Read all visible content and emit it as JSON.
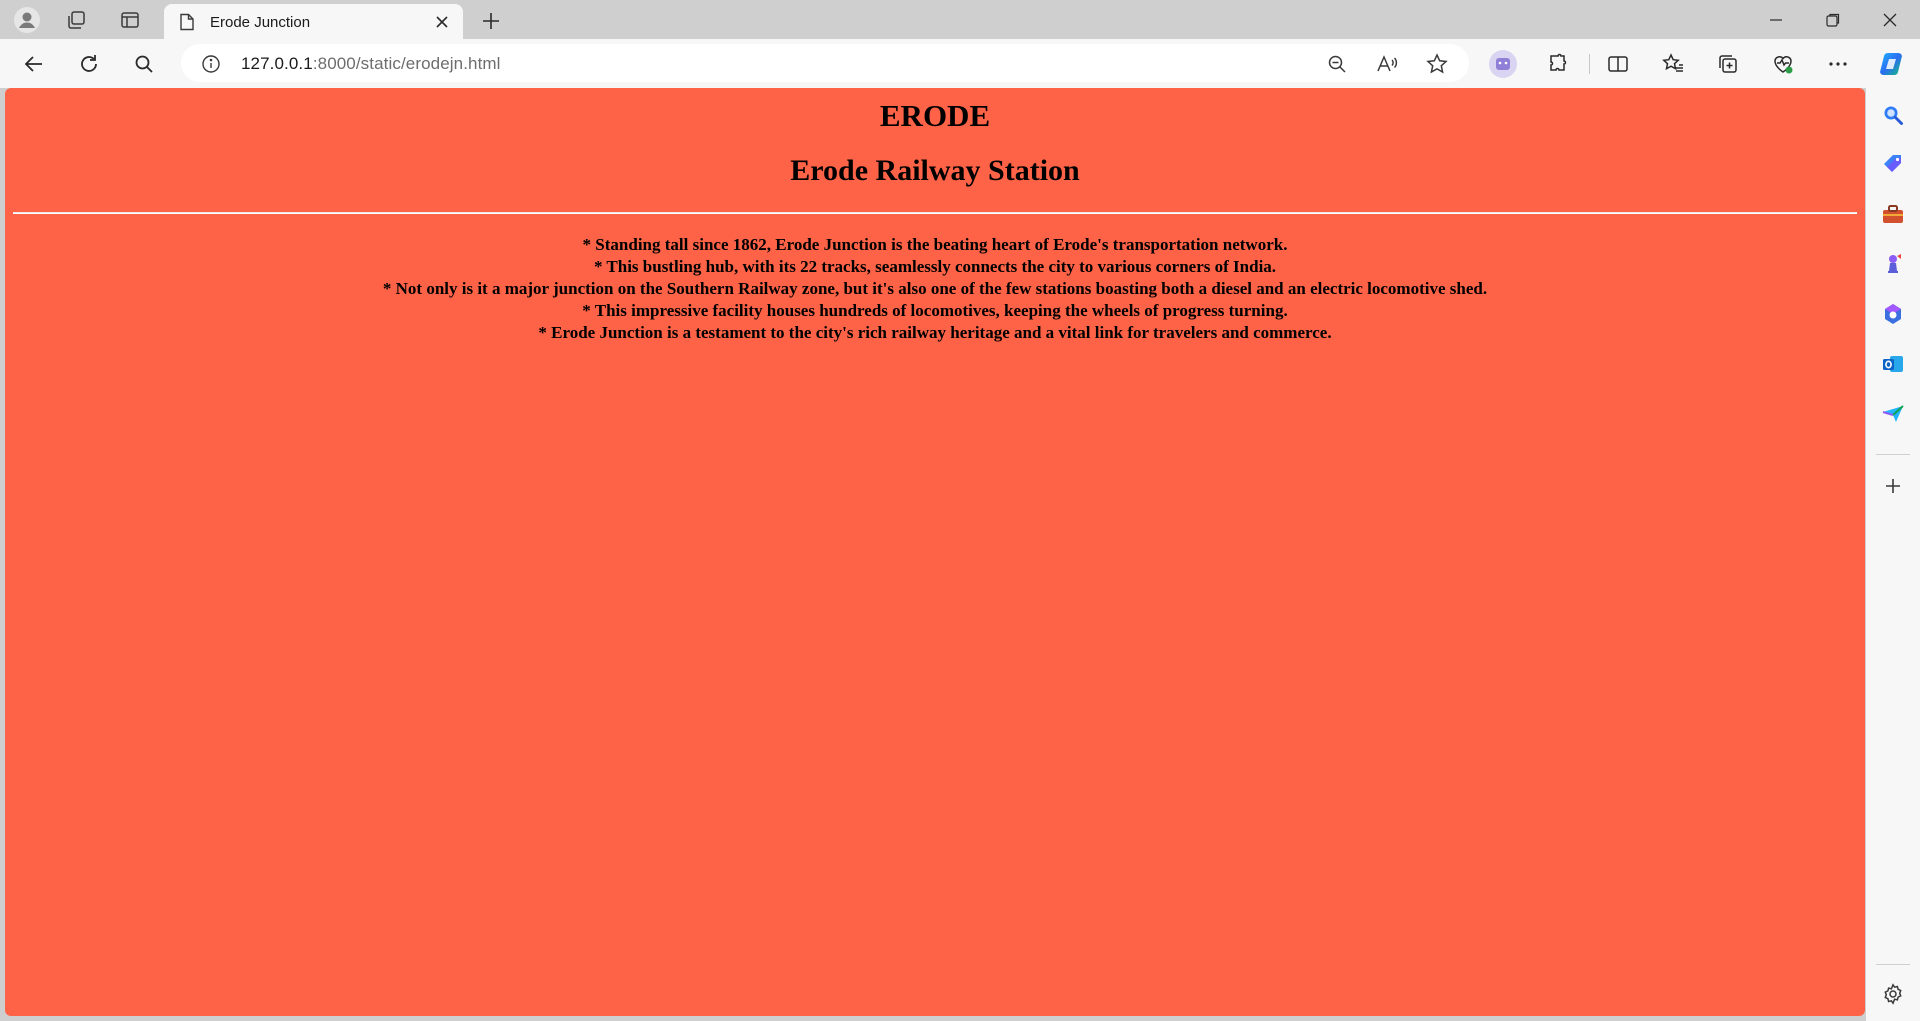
{
  "browser": {
    "tab": {
      "title": "Erode Junction"
    },
    "address": {
      "host": "127.0.0.1",
      "rest": ":8000/static/erodejn.html"
    }
  },
  "page": {
    "heading": "ERODE",
    "subheading": "Erode Railway Station",
    "facts": [
      "* Standing tall since 1862, Erode Junction is the beating heart of Erode's transportation network.",
      "* This bustling hub, with its 22 tracks, seamlessly connects the city to various corners of India.",
      "* Not only is it a major junction on the Southern Railway zone, but it's also one of the few stations boasting both a diesel and an electric locomotive shed.",
      "* This impressive facility houses hundreds of locomotives, keeping the wheels of progress turning.",
      "* Erode Junction is a testament to the city's rich railway heritage and a vital link for travelers and commerce."
    ],
    "colors": {
      "background": "#ff6347",
      "rule": "#ffffff"
    }
  },
  "icons": {
    "tabstrip": [
      "profile-icon",
      "workspaces-icon",
      "tab-actions-icon",
      "page-icon",
      "close-icon",
      "new-tab-icon"
    ],
    "window": [
      "minimize-icon",
      "restore-icon",
      "close-window-icon"
    ],
    "toolbar": [
      "back-icon",
      "refresh-icon",
      "search-icon",
      "site-info-icon",
      "zoom-out-icon",
      "read-aloud-icon",
      "favorite-star-icon",
      "extension-avatar-icon",
      "extensions-icon",
      "split-screen-icon",
      "favorites-icon",
      "collections-icon",
      "browser-essentials-icon",
      "more-icon",
      "copilot-icon"
    ],
    "sidebar": [
      "search-icon",
      "shopping-icon",
      "tools-icon",
      "games-icon",
      "microsoft365-icon",
      "outlook-icon",
      "drop-icon",
      "add-icon",
      "settings-icon"
    ]
  }
}
